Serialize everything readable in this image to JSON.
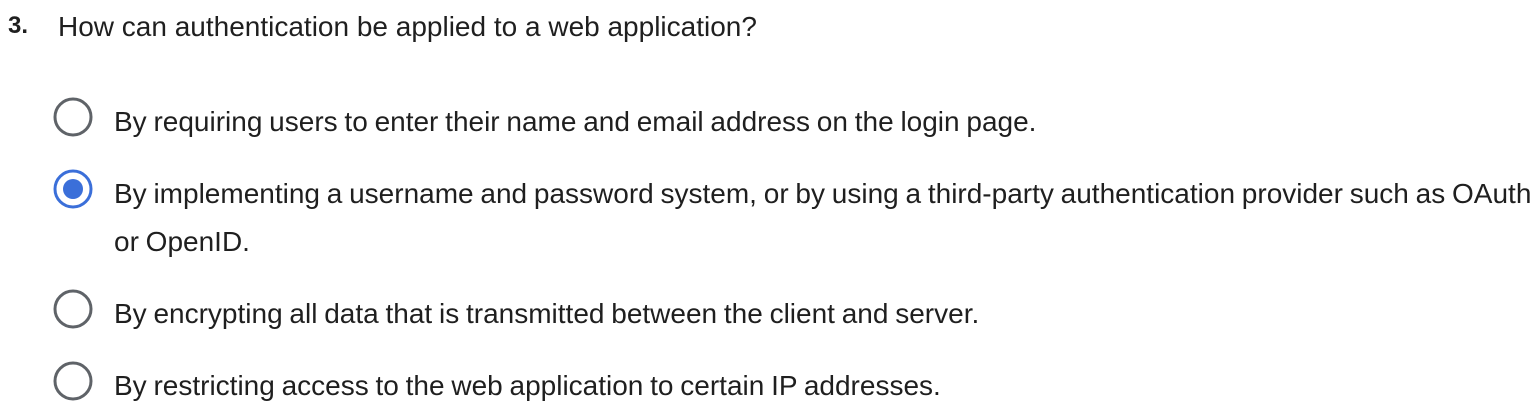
{
  "question": {
    "number": "3.",
    "text": "How can authentication be applied to a web application?",
    "options": [
      {
        "label": "By requiring users to enter their name and email address on the login page.",
        "selected": false
      },
      {
        "label": "By implementing a username and password system, or by using a third-party authentication provider such as OAuth or OpenID.",
        "selected": true
      },
      {
        "label": "By encrypting all data that is transmitted between the client and server.",
        "selected": false
      },
      {
        "label": "By restricting access to the web application to certain IP addresses.",
        "selected": false
      }
    ]
  },
  "colors": {
    "radio_border": "#5f6368",
    "radio_selected": "#3b6fd9",
    "text": "#1f1f1f"
  },
  "icons": {
    "unselected": "radio-unchecked-icon",
    "selected": "radio-checked-icon"
  }
}
